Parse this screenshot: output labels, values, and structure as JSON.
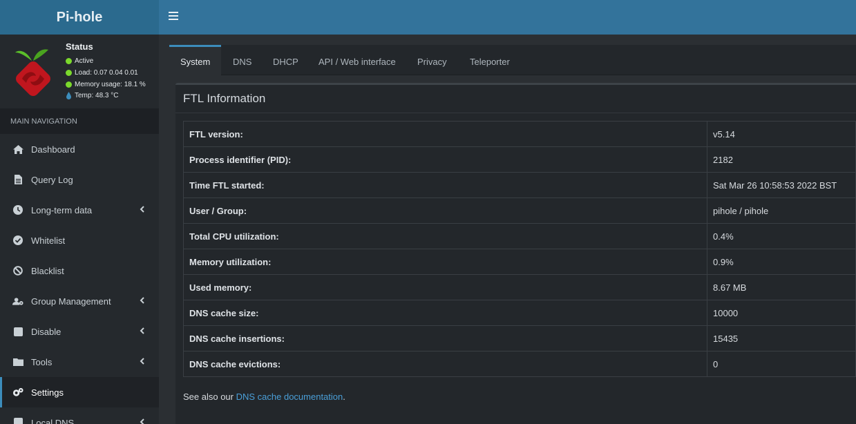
{
  "app": {
    "title": "Pi-hole"
  },
  "status": {
    "title": "Status",
    "active": "Active",
    "load": "Load:  0.07  0.04  0.01",
    "memory": "Memory usage:  18.1 %",
    "temp": "Temp: 48.3 °C"
  },
  "nav": {
    "header": "MAIN NAVIGATION",
    "items": [
      {
        "label": "Dashboard"
      },
      {
        "label": "Query Log"
      },
      {
        "label": "Long-term data"
      },
      {
        "label": "Whitelist"
      },
      {
        "label": "Blacklist"
      },
      {
        "label": "Group Management"
      },
      {
        "label": "Disable"
      },
      {
        "label": "Tools"
      },
      {
        "label": "Settings"
      },
      {
        "label": "Local DNS"
      }
    ]
  },
  "tabs": [
    "System",
    "DNS",
    "DHCP",
    "API / Web interface",
    "Privacy",
    "Teleporter"
  ],
  "ftl": {
    "title": "FTL Information",
    "rows": [
      {
        "key": "FTL version:",
        "value": "v5.14"
      },
      {
        "key": "Process identifier (PID):",
        "value": "2182"
      },
      {
        "key": "Time FTL started:",
        "value": "Sat Mar 26 10:58:53 2022 BST"
      },
      {
        "key": "User / Group:",
        "value": "pihole / pihole"
      },
      {
        "key": "Total CPU utilization:",
        "value": "0.4%"
      },
      {
        "key": "Memory utilization:",
        "value": "0.9%"
      },
      {
        "key": "Used memory:",
        "value": "8.67 MB"
      },
      {
        "key": "DNS cache size:",
        "value": "10000"
      },
      {
        "key": "DNS cache insertions:",
        "value": "15435"
      },
      {
        "key": "DNS cache evictions:",
        "value": "0"
      }
    ],
    "footnote_prefix": "See also our ",
    "footnote_link": "DNS cache documentation",
    "footnote_suffix": "."
  },
  "colors": {
    "accent": "#3c8dbc",
    "header": "#33739b",
    "ok": "#7bd92c"
  }
}
